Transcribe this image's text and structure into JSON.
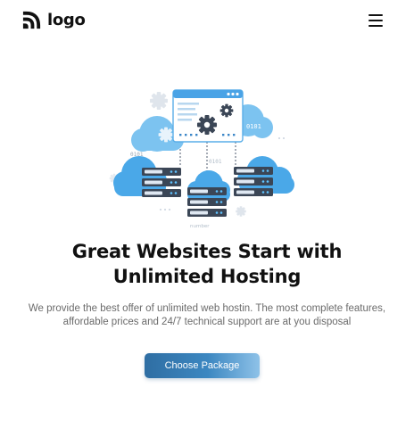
{
  "header": {
    "logo_text": "logo",
    "menu_icon": "hamburger-menu-icon"
  },
  "hero": {
    "illustration": "cloud-hosting-servers-illustration",
    "illustration_labels": [
      "0101",
      "0101",
      "0101",
      "number"
    ],
    "headline_line1": "Great Websites Start with",
    "headline_line2": "Unlimited Hosting",
    "description": "We provide the best offer of unlimited web hostin. The most complete features, affordable prices and 24/7 technical support are at you disposal",
    "cta_label": "Choose Package"
  },
  "colors": {
    "accent": "#3a7fb8",
    "accent_light": "#8ec2e8",
    "cloud": "#4aa8e8",
    "text": "#111111",
    "muted_text": "#6b6b6b"
  }
}
